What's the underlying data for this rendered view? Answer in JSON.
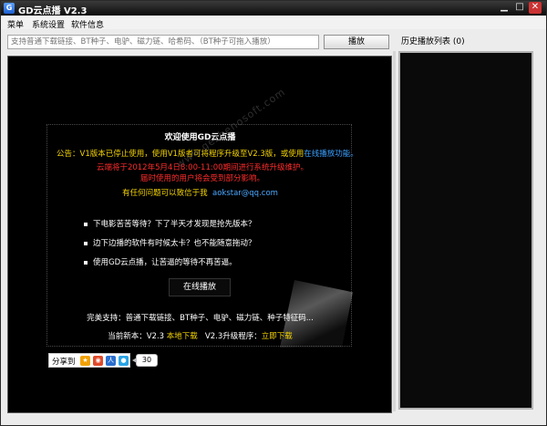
{
  "window": {
    "title": "GD云点播 V2.3"
  },
  "menu": {
    "items": [
      "菜单",
      "系统设置",
      "软件信息"
    ]
  },
  "toolbar": {
    "url_placeholder": "支持普通下载链接、BT种子、电驴、磁力链、哈希码、（BT种子可拖入播放）",
    "play_label": "播放"
  },
  "history": {
    "label": "历史播放列表 (0)"
  },
  "welcome": {
    "title": "欢迎使用GD云点播",
    "notice_prefix": "公告：V1版本已停止使用，使用V1版者可将程序升级至V2.3版，或使用",
    "notice_link": "在线播放功能。",
    "maint_line1": "云端将于2012年5月4日8:00-11:00期间进行系统升级维护。",
    "maint_line2": "届时使用的用户将会受到部分影响。",
    "contact_text": "有任何问题可以致信于我",
    "contact_email": "aokstar@qq.com",
    "watermark": "www.gezhenosoft.com",
    "bullets": [
      "下电影苦苦等待？下了半天才发现是抢先版本？",
      "边下边播的软件有时候太卡？也不能随意拖动？",
      "使用GD云点播，让苦逼的等待不再苦逼。"
    ],
    "online_button": "在线播放",
    "support_text": "完美支持：普通下载链接、BT种子、电驴、磁力链、种子特征码...",
    "version_current": "当前新本：V2.3",
    "local_download": "本地下载",
    "upgrade_label": "V2.3升级程序：",
    "download_now": "立即下载"
  },
  "share": {
    "label": "分享到",
    "count": "30",
    "icons": [
      "qzone-icon",
      "weibo-icon",
      "renren-icon",
      "qq-icon"
    ]
  }
}
